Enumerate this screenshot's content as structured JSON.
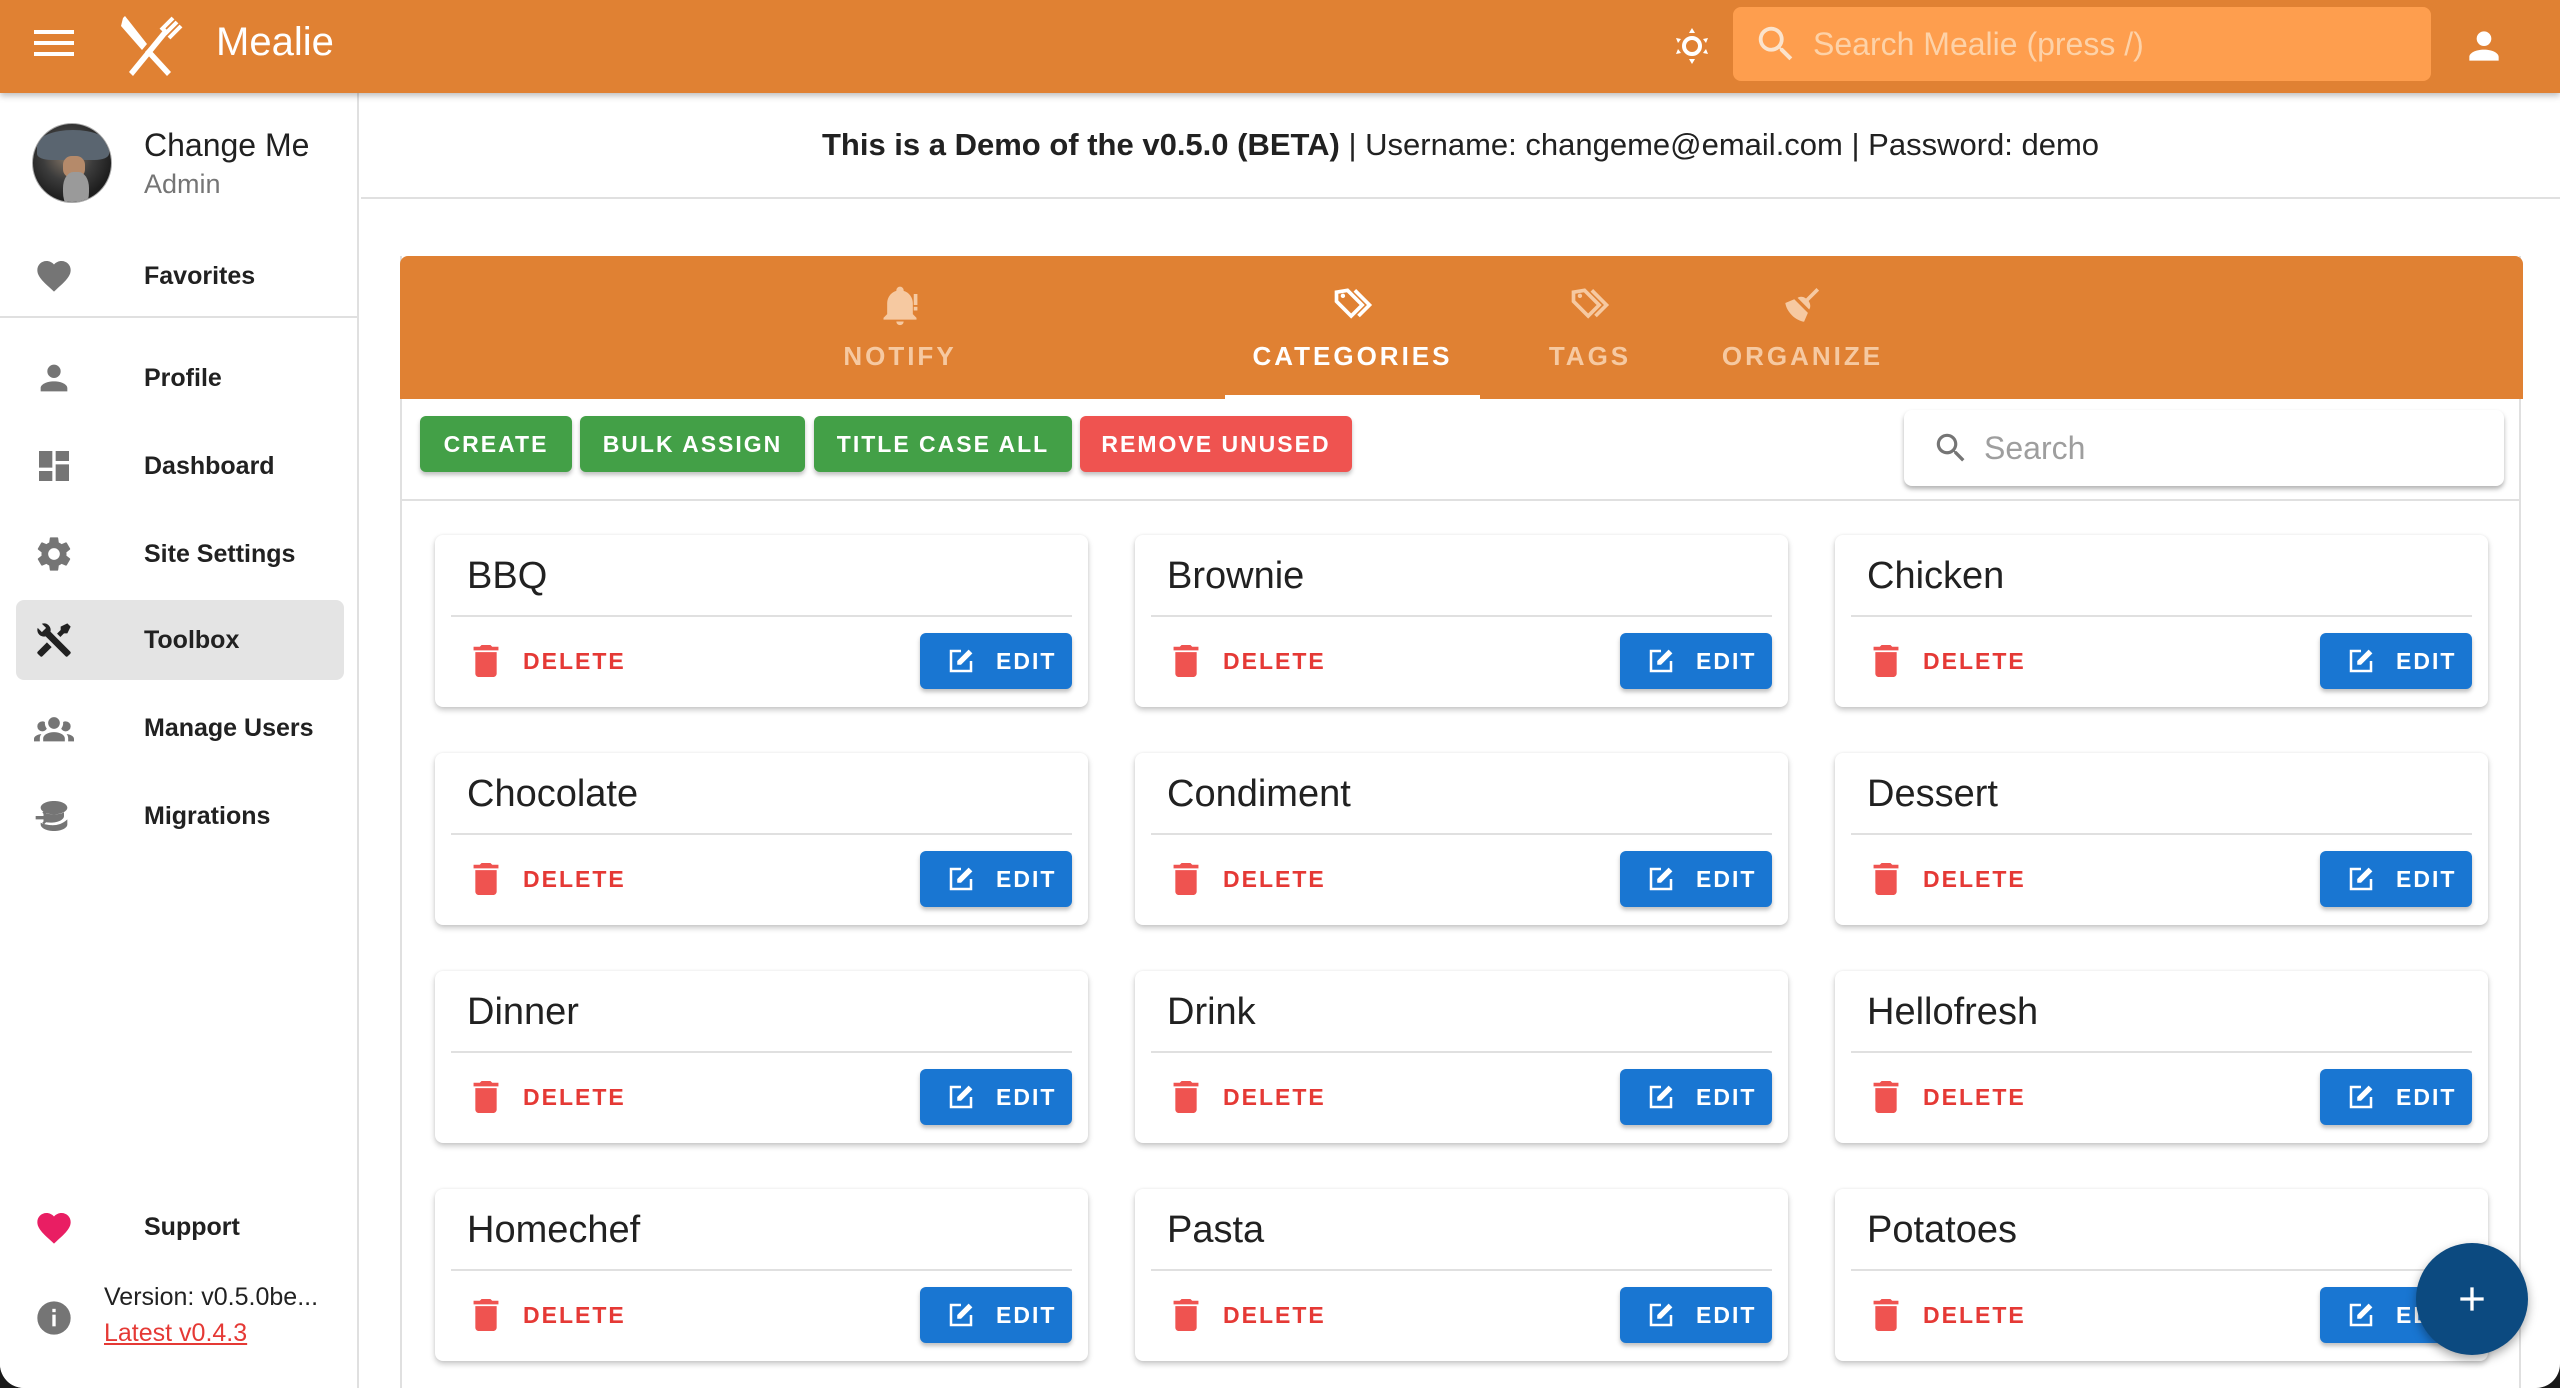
{
  "app": {
    "title": "Mealie",
    "search_placeholder": "Search Mealie (press /)"
  },
  "colors": {
    "primary": "#E08133",
    "search_bg": "#FE9E4E",
    "success": "#43A047",
    "error": "#EF5350",
    "info": "#1976D2",
    "fab": "#0C4A80"
  },
  "sidebar": {
    "user": {
      "name": "Change Me",
      "role": "Admin"
    },
    "favorites": {
      "label": "Favorites",
      "icon": "heart-icon"
    },
    "items": [
      {
        "label": "Profile",
        "icon": "account-icon"
      },
      {
        "label": "Dashboard",
        "icon": "dashboard-icon"
      },
      {
        "label": "Site Settings",
        "icon": "gear-icon"
      },
      {
        "label": "Toolbox",
        "icon": "tools-icon",
        "active": true
      },
      {
        "label": "Manage Users",
        "icon": "account-group-icon"
      },
      {
        "label": "Migrations",
        "icon": "database-import-icon"
      }
    ],
    "support": {
      "label": "Support",
      "icon": "heart-icon"
    },
    "version": {
      "text": "Version: v0.5.0be...",
      "latest_link": "Latest v0.4.3"
    }
  },
  "banner": {
    "bold": "This is a Demo of the v0.5.0 (BETA)",
    "rest": " | Username: changeme@email.com | Password: demo"
  },
  "toolbox": {
    "tabs": [
      {
        "label": "NOTIFY",
        "icon": "bell-alert-icon"
      },
      {
        "label": "CATEGORIES",
        "icon": "tag-multiple-icon",
        "active": true
      },
      {
        "label": "TAGS",
        "icon": "tag-multiple-outline-icon"
      },
      {
        "label": "ORGANIZE",
        "icon": "broom-icon"
      }
    ],
    "actions": {
      "create": "CREATE",
      "bulk_assign": "BULK ASSIGN",
      "title_case_all": "TITLE CASE ALL",
      "remove_unused": "REMOVE UNUSED"
    },
    "search_placeholder": "Search",
    "delete_label": "DELETE",
    "edit_label": "EDIT",
    "categories": [
      "BBQ",
      "Brownie",
      "Chicken",
      "Chocolate",
      "Condiment",
      "Dessert",
      "Dinner",
      "Drink",
      "Hellofresh",
      "Homechef",
      "Pasta",
      "Potatoes"
    ]
  }
}
